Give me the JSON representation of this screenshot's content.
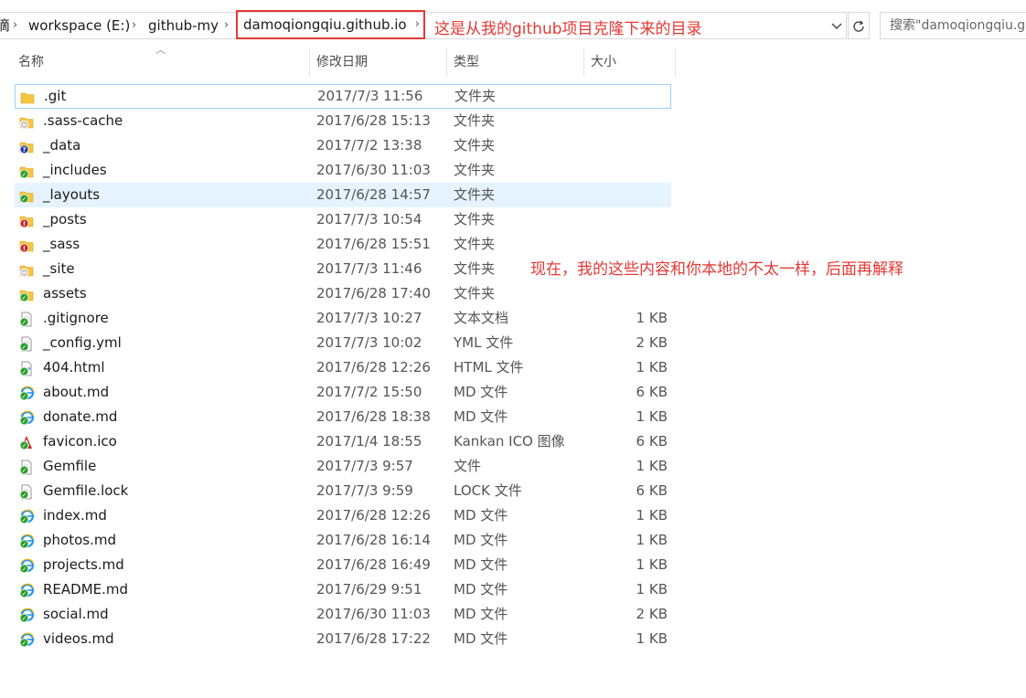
{
  "address_bar": {
    "crumbs": [
      "滴",
      "workspace (E:)",
      "github-my",
      "damoqiongqiu.github.io"
    ],
    "search_placeholder": "搜索\"damoqiongqiu.gi"
  },
  "annotations": {
    "top": "这是从我的github项目克隆下来的目录",
    "middle": "现在，我的这些内容和你本地的不太一样，后面再解释"
  },
  "columns": {
    "name": "名称",
    "modified": "修改日期",
    "type": "类型",
    "size": "大小"
  },
  "files": [
    {
      "name": ".git",
      "date": "2017/7/3 11:56",
      "type": "文件夹",
      "size": "",
      "icon": "folder-icon"
    },
    {
      "name": ".sass-cache",
      "date": "2017/6/28 15:13",
      "type": "文件夹",
      "size": "",
      "icon": "folder-ignored-icon"
    },
    {
      "name": "_data",
      "date": "2017/7/2 13:38",
      "type": "文件夹",
      "size": "",
      "icon": "folder-unversioned-icon"
    },
    {
      "name": "_includes",
      "date": "2017/6/30 11:03",
      "type": "文件夹",
      "size": "",
      "icon": "folder-normal-icon"
    },
    {
      "name": "_layouts",
      "date": "2017/6/28 14:57",
      "type": "文件夹",
      "size": "",
      "icon": "folder-normal-icon"
    },
    {
      "name": "_posts",
      "date": "2017/7/3 10:54",
      "type": "文件夹",
      "size": "",
      "icon": "folder-modified-icon"
    },
    {
      "name": "_sass",
      "date": "2017/6/28 15:51",
      "type": "文件夹",
      "size": "",
      "icon": "folder-modified-icon"
    },
    {
      "name": "_site",
      "date": "2017/7/3 11:46",
      "type": "文件夹",
      "size": "",
      "icon": "folder-ignored-icon"
    },
    {
      "name": "assets",
      "date": "2017/6/28 17:40",
      "type": "文件夹",
      "size": "",
      "icon": "folder-normal-icon"
    },
    {
      "name": ".gitignore",
      "date": "2017/7/3 10:27",
      "type": "文本文档",
      "size": "1 KB",
      "icon": "text-file-icon"
    },
    {
      "name": "_config.yml",
      "date": "2017/7/3 10:02",
      "type": "YML 文件",
      "size": "2 KB",
      "icon": "text-file-icon"
    },
    {
      "name": "404.html",
      "date": "2017/6/28 12:26",
      "type": "HTML 文件",
      "size": "1 KB",
      "icon": "html-file-icon"
    },
    {
      "name": "about.md",
      "date": "2017/7/2 15:50",
      "type": "MD 文件",
      "size": "6 KB",
      "icon": "ie-file-icon"
    },
    {
      "name": "donate.md",
      "date": "2017/6/28 18:38",
      "type": "MD 文件",
      "size": "1 KB",
      "icon": "ie-file-icon"
    },
    {
      "name": "favicon.ico",
      "date": "2017/1/4 18:55",
      "type": "Kankan ICO 图像",
      "size": "6 KB",
      "icon": "kankan-ico-icon"
    },
    {
      "name": "Gemfile",
      "date": "2017/7/3 9:57",
      "type": "文件",
      "size": "1 KB",
      "icon": "text-file-icon"
    },
    {
      "name": "Gemfile.lock",
      "date": "2017/7/3 9:59",
      "type": "LOCK 文件",
      "size": "6 KB",
      "icon": "text-file-icon"
    },
    {
      "name": "index.md",
      "date": "2017/6/28 12:26",
      "type": "MD 文件",
      "size": "1 KB",
      "icon": "ie-file-icon"
    },
    {
      "name": "photos.md",
      "date": "2017/6/28 16:14",
      "type": "MD 文件",
      "size": "1 KB",
      "icon": "ie-file-icon"
    },
    {
      "name": "projects.md",
      "date": "2017/6/28 16:49",
      "type": "MD 文件",
      "size": "1 KB",
      "icon": "ie-file-icon"
    },
    {
      "name": "README.md",
      "date": "2017/6/29 9:51",
      "type": "MD 文件",
      "size": "1 KB",
      "icon": "ie-file-icon"
    },
    {
      "name": "social.md",
      "date": "2017/6/30 11:03",
      "type": "MD 文件",
      "size": "2 KB",
      "icon": "ie-file-icon"
    },
    {
      "name": "videos.md",
      "date": "2017/6/28 17:22",
      "type": "MD 文件",
      "size": "1 KB",
      "icon": "ie-file-icon"
    }
  ],
  "colors": {
    "annotation_red": "#e53935",
    "selection": "#e5f3ff",
    "focus_border": "#99d1ff",
    "badge_green": "#2e9e2e",
    "badge_red": "#c62828",
    "badge_blue": "#1e3aa8",
    "folder_yellow": "#f5c542"
  }
}
